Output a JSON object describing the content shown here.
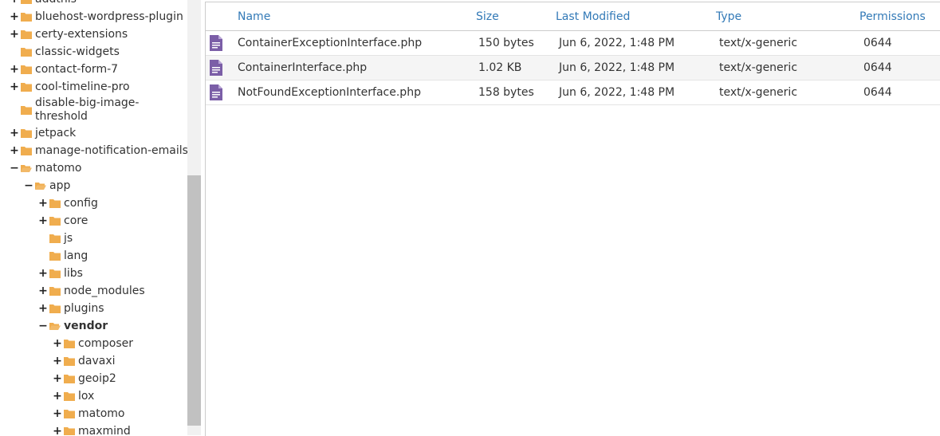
{
  "tree": [
    {
      "label": "addthis",
      "toggle": "+",
      "level": 0
    },
    {
      "label": "bluehost-wordpress-plugin",
      "toggle": "+",
      "level": 0
    },
    {
      "label": "certy-extensions",
      "toggle": "+",
      "level": 0
    },
    {
      "label": "classic-widgets",
      "toggle": "",
      "level": 0
    },
    {
      "label": "contact-form-7",
      "toggle": "+",
      "level": 0
    },
    {
      "label": "cool-timeline-pro",
      "toggle": "+",
      "level": 0
    },
    {
      "label": "disable-big-image-threshold",
      "toggle": "",
      "level": 0
    },
    {
      "label": "jetpack",
      "toggle": "+",
      "level": 0
    },
    {
      "label": "manage-notification-emails",
      "toggle": "+",
      "level": 0
    },
    {
      "label": "matomo",
      "toggle": "−",
      "level": 0,
      "open": true
    },
    {
      "label": "app",
      "toggle": "−",
      "level": 1,
      "open": true
    },
    {
      "label": "config",
      "toggle": "+",
      "level": 2
    },
    {
      "label": "core",
      "toggle": "+",
      "level": 2
    },
    {
      "label": "js",
      "toggle": "",
      "level": 2
    },
    {
      "label": "lang",
      "toggle": "",
      "level": 2
    },
    {
      "label": "libs",
      "toggle": "+",
      "level": 2
    },
    {
      "label": "node_modules",
      "toggle": "+",
      "level": 2
    },
    {
      "label": "plugins",
      "toggle": "+",
      "level": 2
    },
    {
      "label": "vendor",
      "toggle": "−",
      "level": 2,
      "open": true,
      "bold": true
    },
    {
      "label": "composer",
      "toggle": "+",
      "level": 3
    },
    {
      "label": "davaxi",
      "toggle": "+",
      "level": 3
    },
    {
      "label": "geoip2",
      "toggle": "+",
      "level": 3
    },
    {
      "label": "lox",
      "toggle": "+",
      "level": 3
    },
    {
      "label": "matomo",
      "toggle": "+",
      "level": 3
    },
    {
      "label": "maxmind",
      "toggle": "+",
      "level": 3
    }
  ],
  "table": {
    "headers": {
      "name": "Name",
      "size": "Size",
      "modified": "Last Modified",
      "type": "Type",
      "perms": "Permissions"
    },
    "rows": [
      {
        "name": "ContainerExceptionInterface.php",
        "size": "150 bytes",
        "modified": "Jun 6, 2022, 1:48 PM",
        "type": "text/x-generic",
        "perms": "0644"
      },
      {
        "name": "ContainerInterface.php",
        "size": "1.02 KB",
        "modified": "Jun 6, 2022, 1:48 PM",
        "type": "text/x-generic",
        "perms": "0644"
      },
      {
        "name": "NotFoundExceptionInterface.php",
        "size": "158 bytes",
        "modified": "Jun 6, 2022, 1:48 PM",
        "type": "text/x-generic",
        "perms": "0644"
      }
    ]
  },
  "colors": {
    "folder": "#f0ad4e",
    "file_icon": "#7b5ea7",
    "link": "#337ab7"
  }
}
